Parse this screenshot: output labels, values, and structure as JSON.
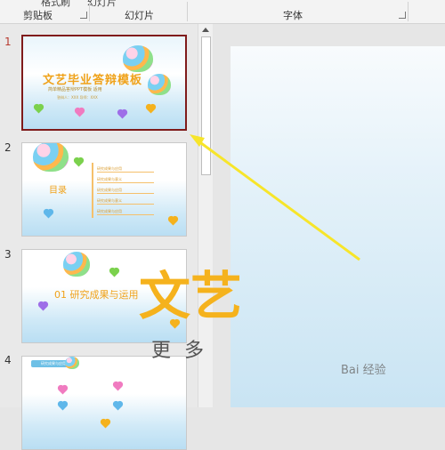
{
  "ribbon": {
    "clipboard_label": "剪贴板",
    "slides_label": "幻灯片",
    "font_label": "字体",
    "cut_text_left": "格式刷",
    "cut_text_mid": "幻灯片"
  },
  "thumbnails": [
    {
      "number": "1",
      "title": "文艺毕业答辩模板",
      "subtitle": "简单精品答辩PPT模板 适用",
      "names": "答辩人：XXX 导师：XXX"
    },
    {
      "number": "2",
      "title": "目录",
      "items": [
        "研究成果与应用",
        "研究成果与意义",
        "研究成果与应用",
        "研究成果与意义",
        "研究成果与应用"
      ]
    },
    {
      "number": "3",
      "title": "01   研究成果与运用"
    },
    {
      "number": "4",
      "head": "研究成果与应用"
    }
  ],
  "main_slide": {
    "title": "文艺",
    "subtitle": "更 多"
  },
  "watermark": "Bai 经验",
  "colors": {
    "accent": "#f0a21a",
    "selected_border": "#7f1b1b",
    "annotation_arrow": "#f7e52a"
  }
}
